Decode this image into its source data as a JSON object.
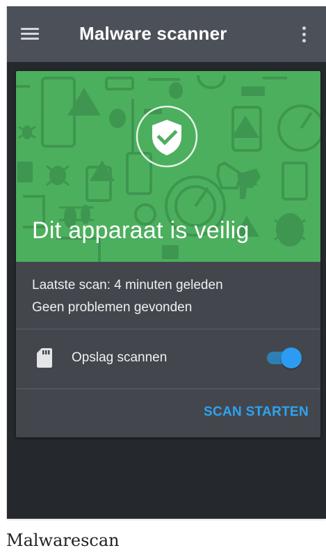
{
  "app_bar": {
    "menu_icon": "hamburger-menu-icon",
    "title": "Malware scanner",
    "more_icon": "more-vertical-icon"
  },
  "status_card": {
    "shield_icon": "shield-check-icon",
    "headline": "Dit apparaat is veilig",
    "last_scan": "Laatste scan: 4 minuten geleden",
    "result": "Geen problemen gevonden",
    "storage_row": {
      "icon": "sd-card-icon",
      "label": "Opslag scannen",
      "toggle_on": true
    },
    "scan_button_label": "SCAN STARTEN"
  },
  "caption": "Malwarescan",
  "colors": {
    "app_bar": "#4c5159",
    "hero_green": "#4caf5d",
    "card": "#43474d",
    "accent": "#2ea3f2",
    "background": "#25282c"
  }
}
